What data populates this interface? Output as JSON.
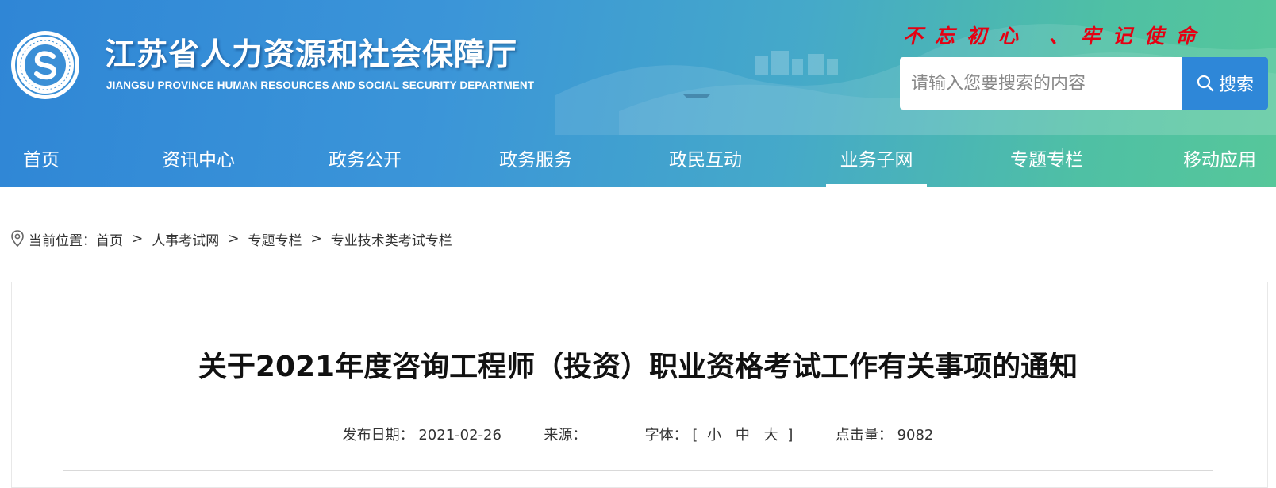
{
  "header": {
    "site_title": "江苏省人力资源和社会保障厅",
    "site_subtitle": "JIANGSU PROVINCE HUMAN RESOURCES AND SOCIAL SECURITY DEPARTMENT",
    "logo_ring_text": "江苏省人力资源和社会保障厅",
    "slogan": "不忘初心 、牢记使命",
    "search": {
      "placeholder": "请输入您要搜索的内容",
      "button_label": "搜索",
      "button_icon": "search-icon"
    }
  },
  "nav": {
    "items": [
      {
        "label": "首页",
        "active": false
      },
      {
        "label": "资讯中心",
        "active": false
      },
      {
        "label": "政务公开",
        "active": false
      },
      {
        "label": "政务服务",
        "active": false
      },
      {
        "label": "政民互动",
        "active": false
      },
      {
        "label": "业务子网",
        "active": true
      },
      {
        "label": "专题专栏",
        "active": false
      },
      {
        "label": "移动应用",
        "active": false
      }
    ]
  },
  "breadcrumb": {
    "icon": "location-pin-icon",
    "prefix": "当前位置：",
    "items": [
      "首页",
      "人事考试网",
      "专题专栏",
      "专业技术类考试专栏"
    ],
    "separator": ">"
  },
  "article": {
    "title": "关于2021年度咨询工程师（投资）职业资格考试工作有关事项的通知",
    "meta": {
      "date_label": "发布日期：",
      "date": "2021-02-26",
      "source_label": "来源：",
      "source": "",
      "fontsize_label": "字体：",
      "fontsize_open": "[",
      "fontsize_small": "小",
      "fontsize_medium": "中",
      "fontsize_large": "大",
      "fontsize_close": "]",
      "views_label": "点击量：",
      "views": "9082"
    }
  },
  "colors": {
    "header_gradient_start": "#2f86d6",
    "header_gradient_end": "#56c79a",
    "slogan": "#e60012",
    "search_button": "#2e87d8"
  }
}
